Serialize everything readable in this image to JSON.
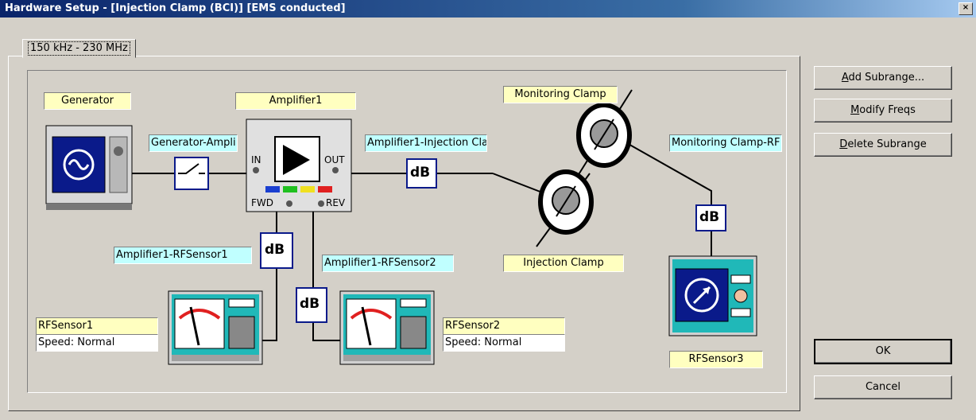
{
  "window": {
    "title": "Hardware Setup  -  [Injection Clamp (BCI)] [EMS conducted]",
    "close": "×"
  },
  "tab": {
    "label": "150 kHz - 230 MHz"
  },
  "buttons": {
    "add_subrange": {
      "pre": "",
      "key": "A",
      "post": "dd Subrange..."
    },
    "modify_freqs": {
      "pre": "",
      "key": "M",
      "post": "odify Freqs"
    },
    "delete_subrange": {
      "pre": "",
      "key": "D",
      "post": "elete Subrange"
    },
    "ok": "OK",
    "cancel": "Cancel"
  },
  "devices": {
    "generator": "Generator",
    "amplifier": "Amplifier1",
    "monitoring_clamp": "Monitoring Clamp",
    "injection_clamp": "Injection Clamp",
    "rfsensor1": {
      "name": "RFSensor1",
      "speed": "Speed: Normal"
    },
    "rfsensor2": {
      "name": "RFSensor2",
      "speed": "Speed: Normal"
    },
    "rfsensor3": "RFSensor3"
  },
  "cables": {
    "gen_amp": "Generator-Ampli",
    "amp_inj": "Amplifier1-Injection Cla",
    "mon_rf": "Monitoring Clamp-RF",
    "amp_rfs1": "Amplifier1-RFSensor1",
    "amp_rfs2": "Amplifier1-RFSensor2"
  },
  "amp_ports": {
    "in": "IN",
    "out": "OUT",
    "fwd": "FWD",
    "rev": "REV"
  },
  "attenuator_label": "dB",
  "colors": {
    "title_start": "#0a246a",
    "label_yellow": "#ffffc0",
    "label_cyan": "#c0ffff",
    "screen_blue": "#0a1a8a",
    "device_teal": "#20b8b8"
  }
}
